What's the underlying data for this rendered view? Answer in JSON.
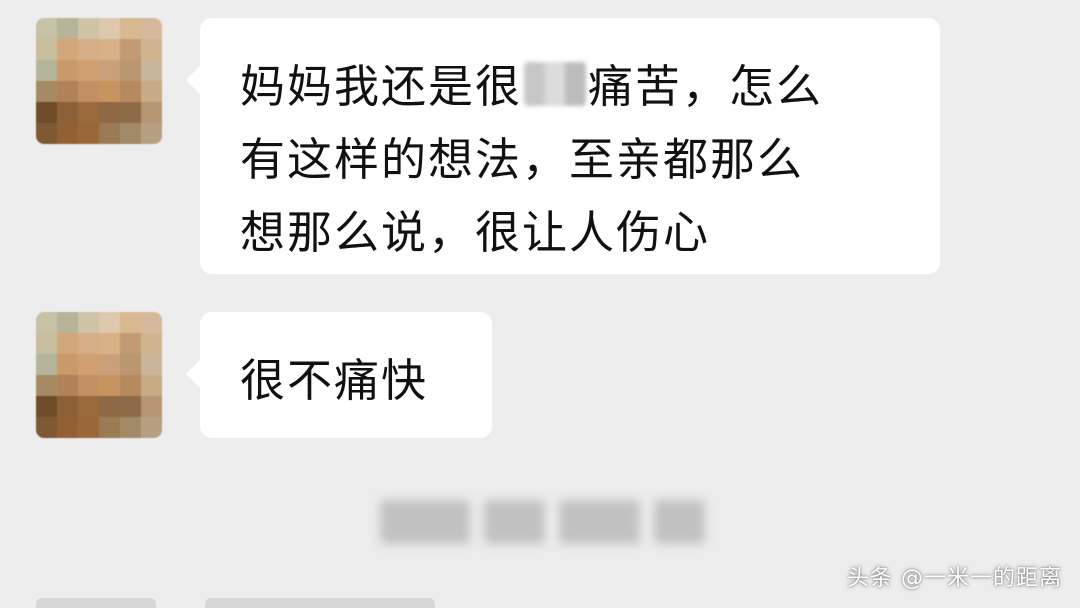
{
  "conversation": {
    "messages": [
      {
        "sender": "other",
        "lines": [
          {
            "before_redaction": "妈妈我还是很",
            "after_redaction": "痛苦，怎么"
          },
          "有这样的想法，至亲都那么",
          "想那么说，很让人伤心"
        ]
      },
      {
        "sender": "other",
        "text": "很不痛快"
      }
    ],
    "timestamp_blurred": "timestamp"
  },
  "avatar": {
    "palette": [
      [
        "#c7c1a6",
        "#b7b49a",
        "#cfc4a8",
        "#ddc8ad",
        "#d8b890",
        "#d6b99d"
      ],
      [
        "#c8be9d",
        "#d2a779",
        "#d4ae87",
        "#d8b187",
        "#c29a73",
        "#cfb48e"
      ],
      [
        "#b4b39c",
        "#c89a69",
        "#d1a070",
        "#caa07a",
        "#ba9770",
        "#c8b59a"
      ],
      [
        "#a68b62",
        "#b18157",
        "#c48e63",
        "#c7935f",
        "#b68a5e",
        "#c7ab84"
      ],
      [
        "#6f4b2a",
        "#8d6138",
        "#9b6a3b",
        "#8f6845",
        "#8e6a46",
        "#b69572"
      ],
      [
        "#7d5a34",
        "#935f33",
        "#9a6838",
        "#9a7b54",
        "#a38a66",
        "#b7a081"
      ]
    ]
  },
  "watermark": {
    "text": "头条 @一米一的距离"
  }
}
